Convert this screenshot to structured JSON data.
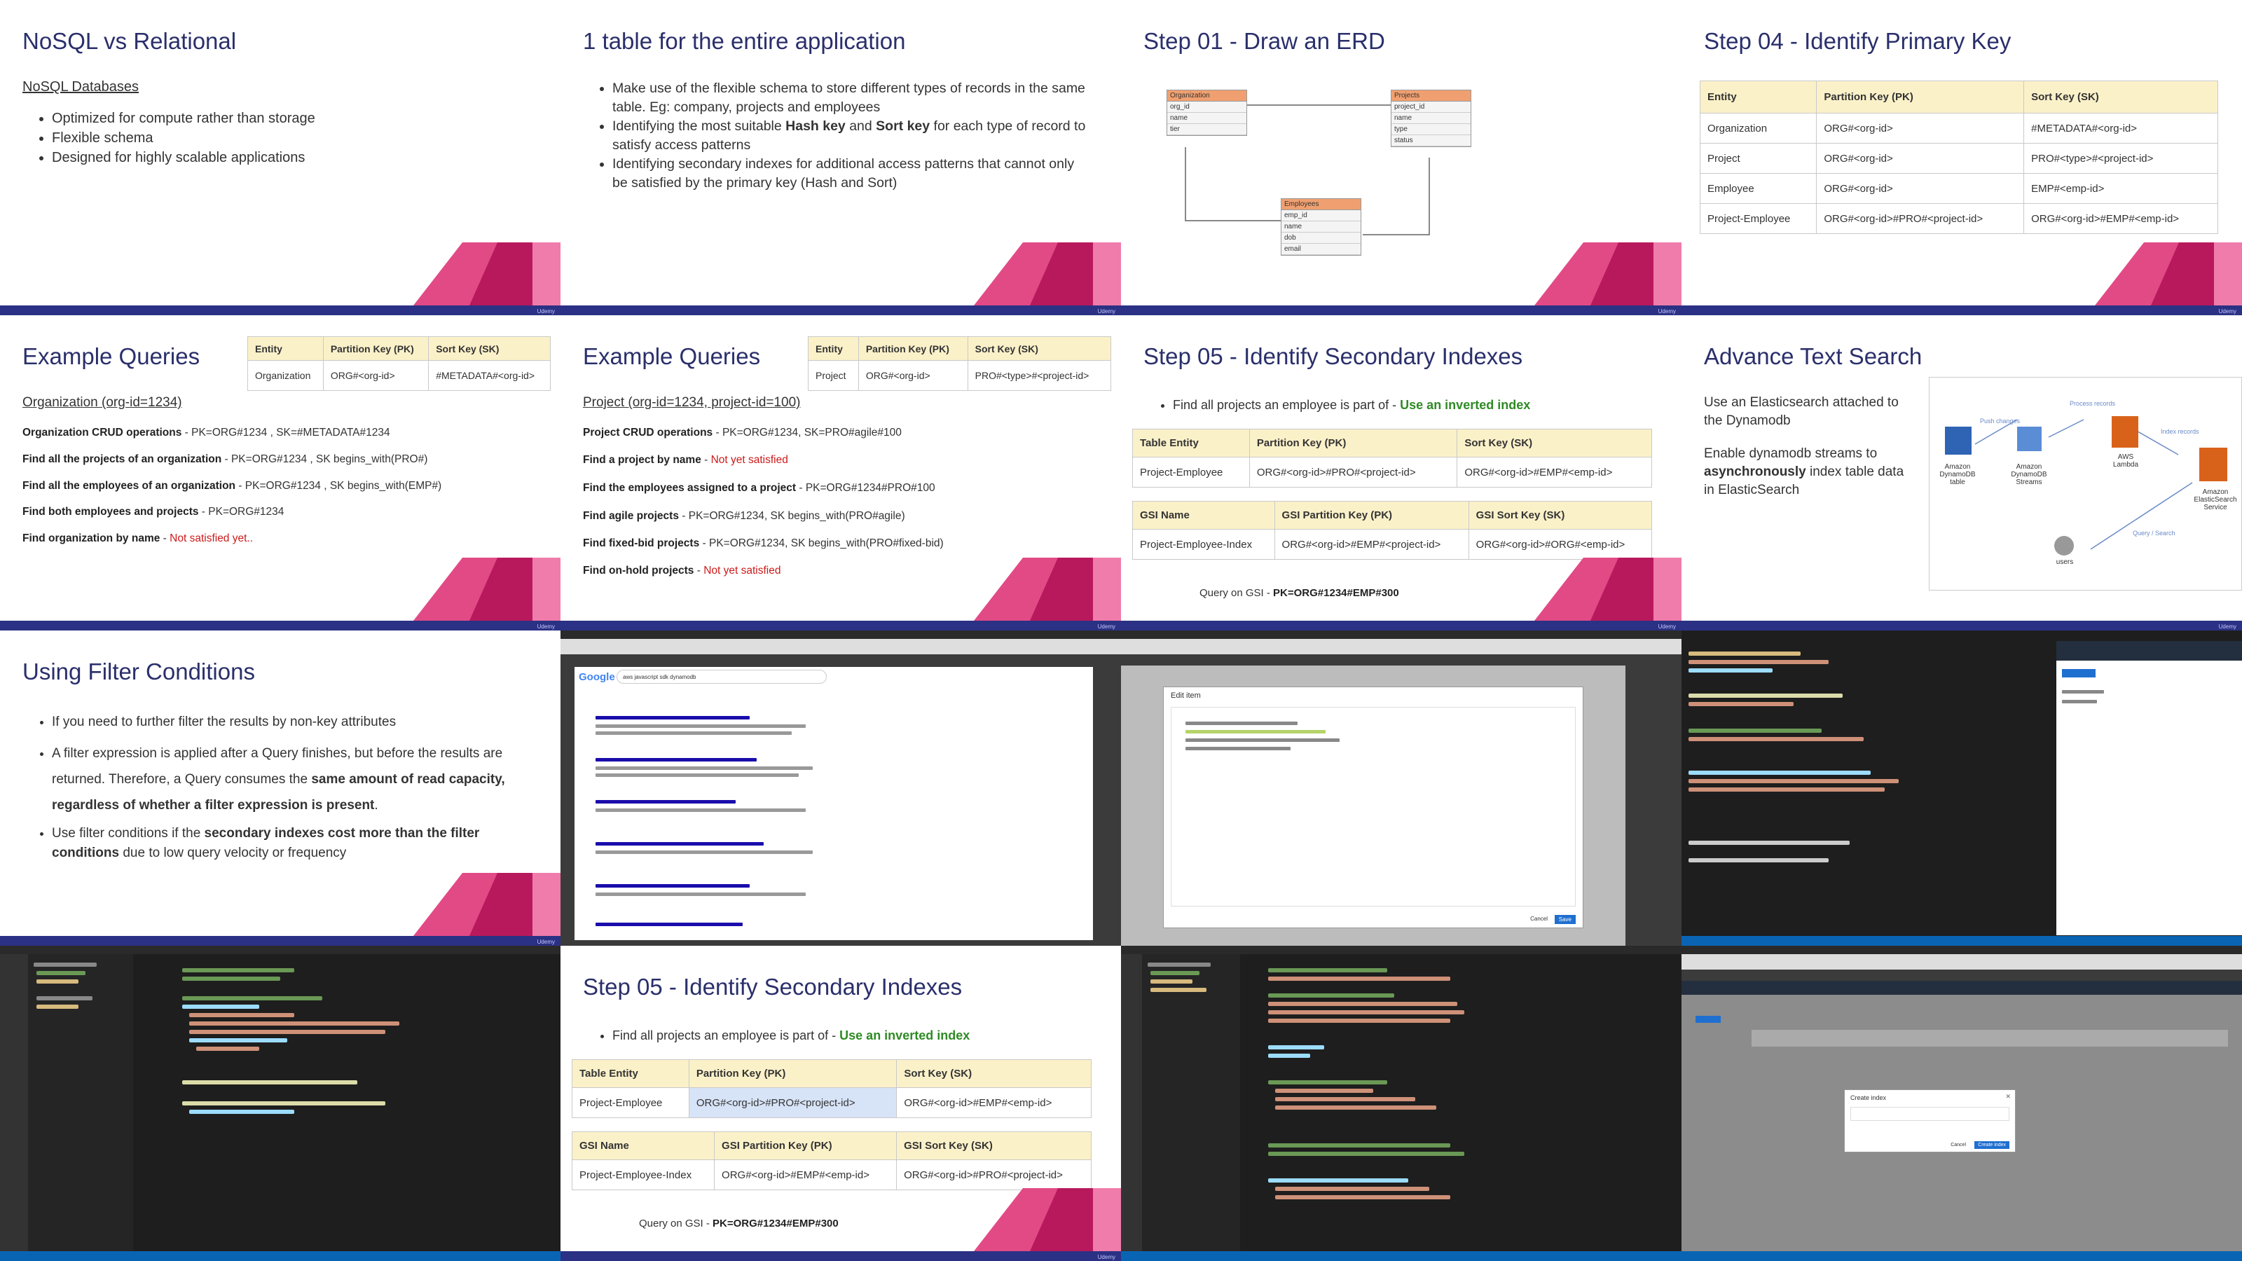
{
  "slides": {
    "s1": {
      "title": "NoSQL vs Relational",
      "subtitle": "NoSQL Databases",
      "bullets": [
        "Optimized for compute rather than storage",
        "Flexible schema",
        "Designed for highly scalable applications"
      ]
    },
    "s2": {
      "title": "1 table for the entire application",
      "bullets": [
        "Make use of the flexible schema to store different types of records in the same table. Eg: company, projects and employees",
        "Identifying the most suitable ",
        "Identifying secondary indexes for additional access patterns that cannot only be satisfied by the primary key (Hash and Sort)"
      ],
      "b2_hash": "Hash key",
      "b2_and": " and ",
      "b2_sort": "Sort key",
      "b2_rest": " for each type of record to satisfy access patterns"
    },
    "s3": {
      "title": "Step 01 - Draw an ERD",
      "org": {
        "name": "Organization",
        "rows": [
          "org_id",
          "name",
          "tier"
        ]
      },
      "proj": {
        "name": "Projects",
        "rows": [
          "project_id",
          "name",
          "type",
          "status"
        ]
      },
      "emp": {
        "name": "Employees",
        "rows": [
          "emp_id",
          "name",
          "dob",
          "email"
        ]
      }
    },
    "s4": {
      "title": "Step 04 - Identify Primary Key",
      "headers": [
        "Entity",
        "Partition Key (PK)",
        "Sort Key (SK)"
      ],
      "rows": [
        [
          "Organization",
          "ORG#<org-id>",
          "#METADATA#<org-id>"
        ],
        [
          "Project",
          "ORG#<org-id>",
          "PRO#<type>#<project-id>"
        ],
        [
          "Employee",
          "ORG#<org-id>",
          "EMP#<emp-id>"
        ],
        [
          "Project-Employee",
          "ORG#<org-id>#PRO#<project-id>",
          "ORG#<org-id>#EMP#<emp-id>"
        ]
      ]
    },
    "s5": {
      "title": "Example Queries",
      "headers": [
        "Entity",
        "Partition Key (PK)",
        "Sort Key (SK)"
      ],
      "row": [
        "Organization",
        "ORG#<org-id>",
        "#METADATA#<org-id>"
      ],
      "subtitle": "Organization (org-id=1234)",
      "lines": [
        {
          "b": "Organization CRUD operations",
          "t": " - PK=ORG#1234 , SK=#METADATA#1234"
        },
        {
          "b": "Find all the projects of an organization",
          "t": " - PK=ORG#1234 , SK begins_with(PRO#)"
        },
        {
          "b": "Find all the employees of an organization",
          "t": " - PK=ORG#1234 , SK begins_with(EMP#)"
        },
        {
          "b": "Find both employees and projects ",
          "t": " - PK=ORG#1234"
        },
        {
          "b": "Find organization by name",
          "t": " - ",
          "r": "Not satisfied yet.."
        }
      ]
    },
    "s6": {
      "title": "Example Queries",
      "headers": [
        "Entity",
        "Partition Key (PK)",
        "Sort Key (SK)"
      ],
      "row": [
        "Project",
        "ORG#<org-id>",
        "PRO#<type>#<project-id>"
      ],
      "subtitle": "Project (org-id=1234, project-id=100)",
      "lines": [
        {
          "b": "Project CRUD operations",
          "t": " - PK=ORG#1234, SK=PRO#agile#100"
        },
        {
          "b": "Find a project by name",
          "t": " - ",
          "r": "Not yet satisfied"
        },
        {
          "b": "Find the employees assigned to a project",
          "t": " - PK=ORG#1234#PRO#100"
        },
        {
          "b": "Find agile projects",
          "t": " - PK=ORG#1234, SK begins_with(PRO#agile)"
        },
        {
          "b": "Find fixed-bid projects",
          "t": " - PK=ORG#1234, SK begins_with(PRO#fixed-bid)"
        },
        {
          "b": "Find on-hold projects",
          "t": " - ",
          "r": "Not yet satisfied"
        }
      ]
    },
    "s7": {
      "title": "Step 05 - Identify Secondary Indexes",
      "bullet": "Find all projects an employee is part of - ",
      "bullet_green": "Use an inverted index",
      "t1_headers": [
        "Table Entity",
        "Partition Key (PK)",
        "Sort Key (SK)"
      ],
      "t1_row": [
        "Project-Employee",
        "ORG#<org-id>#PRO#<project-id>",
        "ORG#<org-id>#EMP#<emp-id>"
      ],
      "t2_headers": [
        "GSI Name",
        "GSI Partition Key (PK)",
        "GSI Sort Key (SK)"
      ],
      "t2_row": [
        "Project-Employee-Index",
        "ORG#<org-id>#EMP#<project-id>",
        "ORG#<org-id>#ORG#<emp-id>"
      ],
      "query_prefix": "Query on GSI - ",
      "query_bold": "PK=ORG#1234#EMP#300"
    },
    "s8": {
      "title": "Advance Text Search",
      "p1": "Use an Elasticsearch attached to the Dynamodb",
      "p2a": "Enable dynamodb streams to ",
      "p2b": "asynchronously",
      "p2c": " index table data in ElasticSearch",
      "nodes": [
        "Amazon DynamoDB table",
        "Amazon DynamoDB Streams",
        "AWS Lambda",
        "Amazon ElasticSearch Service",
        "users"
      ],
      "arrows": [
        "Push changes",
        "Process records",
        "Index records",
        "Query / Search"
      ]
    },
    "s9": {
      "title": "Using Filter Conditions",
      "b1": "If you need to further filter the results by non-key attributes",
      "b2a": "A filter expression is applied after a Query finishes, but before the results are returned. Therefore, a Query consumes the ",
      "b2b": "same amount of read capacity, regardless of whether a filter expression is present",
      "b2c": ".",
      "b3a": "Use filter conditions if the ",
      "b3b": "secondary indexes cost more than the filter conditions",
      "b3c": " due to low query velocity or frequency"
    },
    "s14": {
      "title": "Step 05 - Identify Secondary Indexes",
      "bullet": "Find all projects an employee is part of - ",
      "bullet_green": "Use an inverted index",
      "t1_headers": [
        "Table Entity",
        "Partition Key (PK)",
        "Sort Key (SK)"
      ],
      "t1_row": [
        "Project-Employee",
        "ORG#<org-id>#PRO#<project-id>",
        "ORG#<org-id>#EMP#<emp-id>"
      ],
      "t2_headers": [
        "GSI Name",
        "GSI Partition Key (PK)",
        "GSI Sort Key (SK)"
      ],
      "t2_row": [
        "Project-Employee-Index",
        "ORG#<org-id>#EMP#<emp-id>",
        "ORG#<org-id>#PRO#<project-id>"
      ],
      "query_prefix": "Query on GSI - ",
      "query_bold": "PK=ORG#1234#EMP#300"
    }
  },
  "screens": {
    "google": {
      "logo": "Google",
      "query": "aws javascript sdk dynamodb"
    },
    "edit_item": {
      "title": "Edit item",
      "cancel": "Cancel",
      "save": "Save"
    },
    "create_index": {
      "title": "Create index",
      "cancel": "Cancel",
      "create": "Create index"
    }
  },
  "footer": "Udemy",
  "colors": {
    "title": "#2a2f6b",
    "bar": "#2b3184",
    "deco1": "#e24a86",
    "deco2": "#b8195c",
    "deco3": "#f07cab",
    "header_fill": "#fbf1c9",
    "green": "#2e8b24",
    "red": "#cc1a1a"
  }
}
